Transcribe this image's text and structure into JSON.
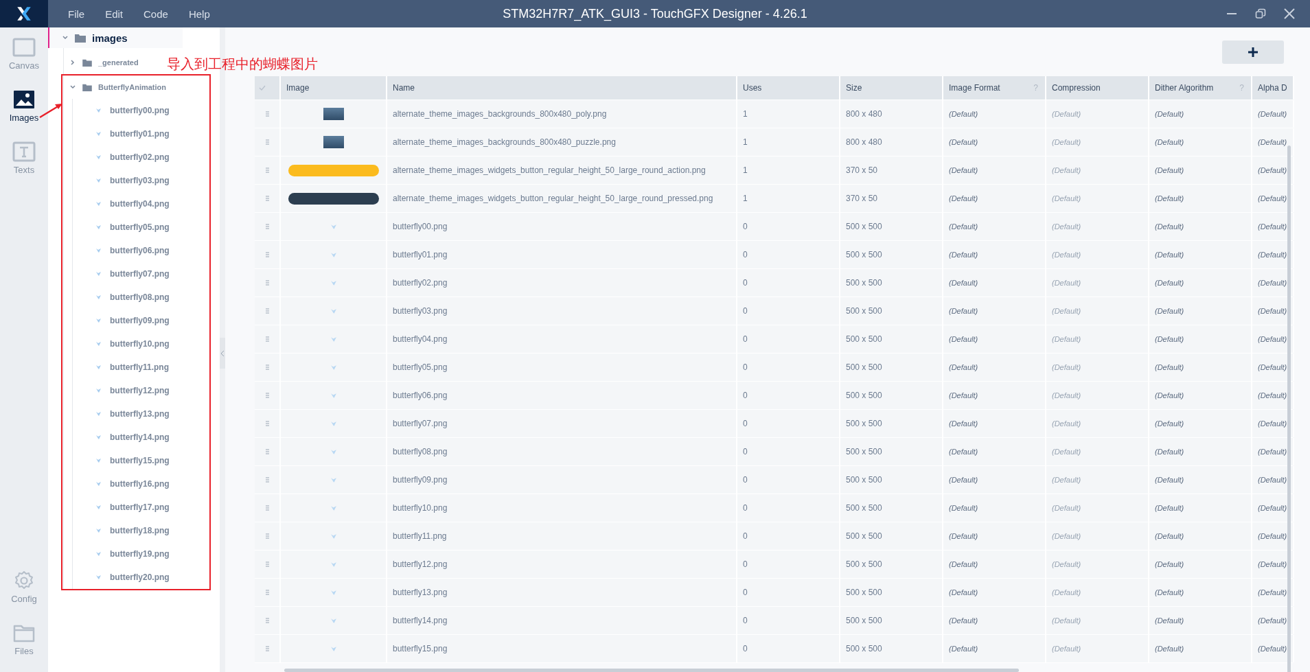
{
  "window": {
    "title": "STM32H7R7_ATK_GUI3 - TouchGFX Designer - 4.26.1"
  },
  "menu": [
    "File",
    "Edit",
    "Code",
    "Help"
  ],
  "rail": {
    "top": [
      {
        "kind": "canvas",
        "label": "Canvas",
        "selected": false
      },
      {
        "kind": "images",
        "label": "Images",
        "selected": true
      },
      {
        "kind": "texts",
        "label": "Texts",
        "selected": false
      }
    ],
    "bottom": [
      {
        "kind": "config",
        "label": "Config",
        "selected": false
      },
      {
        "kind": "files",
        "label": "Files",
        "selected": false
      }
    ]
  },
  "annotation": {
    "text": "导入到工程中的蝴蝶图片"
  },
  "tree": [
    {
      "label": "images",
      "expanded": true,
      "children": [
        {
          "label": "_generated",
          "expanded": false
        },
        {
          "label": "ButterflyAnimation",
          "expanded": true,
          "annotated": true,
          "children": [
            {
              "label": "butterfly00.png"
            },
            {
              "label": "butterfly01.png"
            },
            {
              "label": "butterfly02.png"
            },
            {
              "label": "butterfly03.png"
            },
            {
              "label": "butterfly04.png"
            },
            {
              "label": "butterfly05.png"
            },
            {
              "label": "butterfly06.png"
            },
            {
              "label": "butterfly07.png"
            },
            {
              "label": "butterfly08.png"
            },
            {
              "label": "butterfly09.png"
            },
            {
              "label": "butterfly10.png"
            },
            {
              "label": "butterfly11.png"
            },
            {
              "label": "butterfly12.png"
            },
            {
              "label": "butterfly13.png"
            },
            {
              "label": "butterfly14.png"
            },
            {
              "label": "butterfly15.png"
            },
            {
              "label": "butterfly16.png"
            },
            {
              "label": "butterfly17.png"
            },
            {
              "label": "butterfly18.png"
            },
            {
              "label": "butterfly19.png"
            },
            {
              "label": "butterfly20.png"
            }
          ]
        }
      ]
    }
  ],
  "table": {
    "columns": [
      {
        "label": "Image"
      },
      {
        "label": "Name"
      },
      {
        "label": "Uses"
      },
      {
        "label": "Size"
      },
      {
        "label": "Image Format",
        "help": "?"
      },
      {
        "label": "Compression"
      },
      {
        "label": "Dither Algorithm",
        "help": "?"
      },
      {
        "label": "Alpha D"
      }
    ],
    "rows": [
      {
        "kind": "photo",
        "name": "alternate_theme_images_backgrounds_800x480_poly.png",
        "uses": "1",
        "size": "800 x 480",
        "format": "(Default)",
        "compression": "(Default)",
        "dither": "(Default)",
        "alpha": "(Default)"
      },
      {
        "kind": "photo",
        "name": "alternate_theme_images_backgrounds_800x480_puzzle.png",
        "uses": "1",
        "size": "800 x 480",
        "format": "(Default)",
        "compression": "(Default)",
        "dither": "(Default)",
        "alpha": "(Default)"
      },
      {
        "kind": "yellow-pill",
        "name": "alternate_theme_images_widgets_button_regular_height_50_large_round_action.png",
        "uses": "1",
        "size": "370 x 50",
        "format": "(Default)",
        "compression": "(Default)",
        "dither": "(Default)",
        "alpha": "(Default)"
      },
      {
        "kind": "dark-pill",
        "name": "alternate_theme_images_widgets_button_regular_height_50_large_round_pressed.png",
        "uses": "1",
        "size": "370 x 50",
        "format": "(Default)",
        "compression": "(Default)",
        "dither": "(Default)",
        "alpha": "(Default)"
      },
      {
        "kind": "butterfly",
        "name": "butterfly00.png",
        "uses": "0",
        "size": "500 x 500",
        "format": "(Default)",
        "compression": "(Default)",
        "dither": "(Default)",
        "alpha": "(Default)"
      },
      {
        "kind": "butterfly",
        "name": "butterfly01.png",
        "uses": "0",
        "size": "500 x 500",
        "format": "(Default)",
        "compression": "(Default)",
        "dither": "(Default)",
        "alpha": "(Default)"
      },
      {
        "kind": "butterfly",
        "name": "butterfly02.png",
        "uses": "0",
        "size": "500 x 500",
        "format": "(Default)",
        "compression": "(Default)",
        "dither": "(Default)",
        "alpha": "(Default)"
      },
      {
        "kind": "butterfly",
        "name": "butterfly03.png",
        "uses": "0",
        "size": "500 x 500",
        "format": "(Default)",
        "compression": "(Default)",
        "dither": "(Default)",
        "alpha": "(Default)"
      },
      {
        "kind": "butterfly",
        "name": "butterfly04.png",
        "uses": "0",
        "size": "500 x 500",
        "format": "(Default)",
        "compression": "(Default)",
        "dither": "(Default)",
        "alpha": "(Default)"
      },
      {
        "kind": "butterfly",
        "name": "butterfly05.png",
        "uses": "0",
        "size": "500 x 500",
        "format": "(Default)",
        "compression": "(Default)",
        "dither": "(Default)",
        "alpha": "(Default)"
      },
      {
        "kind": "butterfly",
        "name": "butterfly06.png",
        "uses": "0",
        "size": "500 x 500",
        "format": "(Default)",
        "compression": "(Default)",
        "dither": "(Default)",
        "alpha": "(Default)"
      },
      {
        "kind": "butterfly",
        "name": "butterfly07.png",
        "uses": "0",
        "size": "500 x 500",
        "format": "(Default)",
        "compression": "(Default)",
        "dither": "(Default)",
        "alpha": "(Default)"
      },
      {
        "kind": "butterfly",
        "name": "butterfly08.png",
        "uses": "0",
        "size": "500 x 500",
        "format": "(Default)",
        "compression": "(Default)",
        "dither": "(Default)",
        "alpha": "(Default)"
      },
      {
        "kind": "butterfly",
        "name": "butterfly09.png",
        "uses": "0",
        "size": "500 x 500",
        "format": "(Default)",
        "compression": "(Default)",
        "dither": "(Default)",
        "alpha": "(Default)"
      },
      {
        "kind": "butterfly",
        "name": "butterfly10.png",
        "uses": "0",
        "size": "500 x 500",
        "format": "(Default)",
        "compression": "(Default)",
        "dither": "(Default)",
        "alpha": "(Default)"
      },
      {
        "kind": "butterfly",
        "name": "butterfly11.png",
        "uses": "0",
        "size": "500 x 500",
        "format": "(Default)",
        "compression": "(Default)",
        "dither": "(Default)",
        "alpha": "(Default)"
      },
      {
        "kind": "butterfly",
        "name": "butterfly12.png",
        "uses": "0",
        "size": "500 x 500",
        "format": "(Default)",
        "compression": "(Default)",
        "dither": "(Default)",
        "alpha": "(Default)"
      },
      {
        "kind": "butterfly",
        "name": "butterfly13.png",
        "uses": "0",
        "size": "500 x 500",
        "format": "(Default)",
        "compression": "(Default)",
        "dither": "(Default)",
        "alpha": "(Default)"
      },
      {
        "kind": "butterfly",
        "name": "butterfly14.png",
        "uses": "0",
        "size": "500 x 500",
        "format": "(Default)",
        "compression": "(Default)",
        "dither": "(Default)",
        "alpha": "(Default)"
      },
      {
        "kind": "butterfly",
        "name": "butterfly15.png",
        "uses": "0",
        "size": "500 x 500",
        "format": "(Default)",
        "compression": "(Default)",
        "dither": "(Default)",
        "alpha": "(Default)"
      }
    ]
  }
}
